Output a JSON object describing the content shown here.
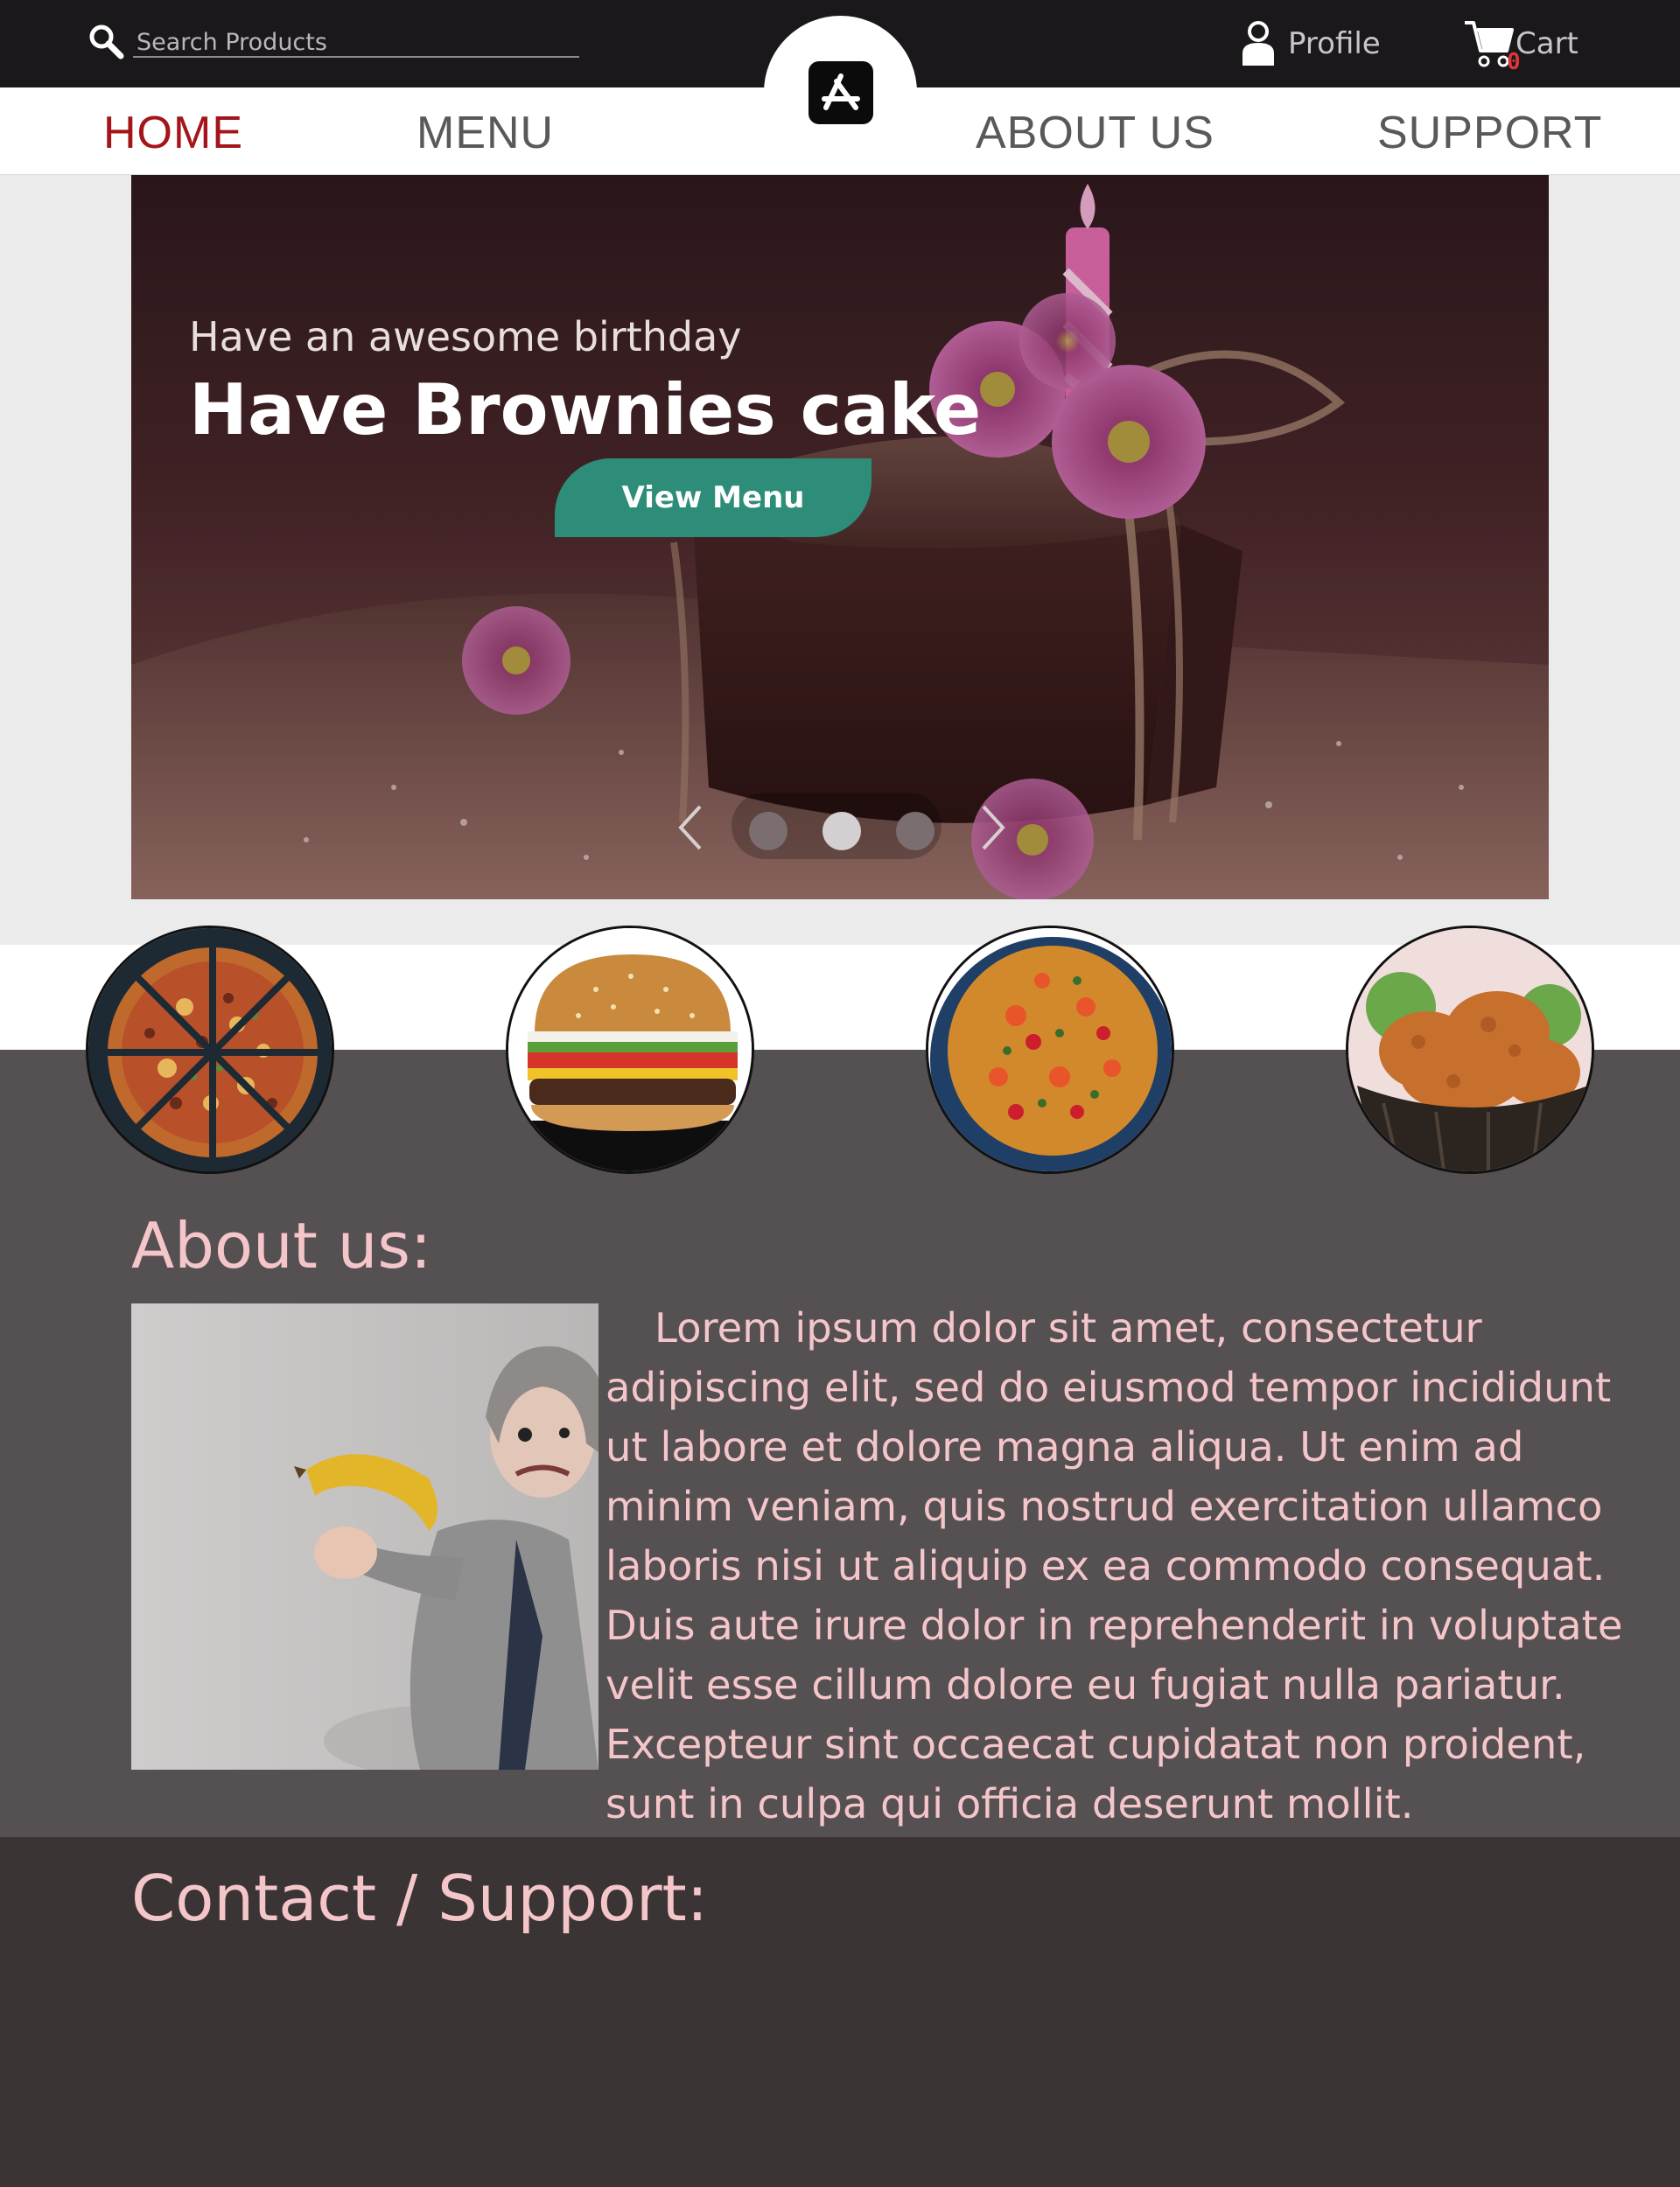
{
  "header": {
    "search": {
      "placeholder": "Search Products",
      "value": ""
    },
    "profile_label": "Profile",
    "cart_label": "Cart",
    "cart_count": "0"
  },
  "nav": {
    "items": [
      {
        "label": "HOME",
        "active": true
      },
      {
        "label": "MENU",
        "active": false
      },
      {
        "label": "ABOUT US",
        "active": false
      },
      {
        "label": "SUPPORT",
        "active": false
      }
    ]
  },
  "hero": {
    "subtitle": "Have an awesome birthday",
    "title": "Have Brownies cake",
    "button_label": "View Menu",
    "slides": {
      "count": 3,
      "active_index": 1
    }
  },
  "food_items": [
    {
      "name": "pizza"
    },
    {
      "name": "burger"
    },
    {
      "name": "paella"
    },
    {
      "name": "fried-chicken"
    }
  ],
  "about": {
    "title": "About us:",
    "text": "Lorem ipsum dolor sit amet, consectetur adipiscing elit, sed do eiusmod tempor incididunt ut labore et dolore magna aliqua. Ut enim ad minim veniam, quis nostrud exercitation ullamco laboris nisi ut aliquip ex ea commodo consequat. Duis aute irure dolor in reprehenderit in voluptate velit esse cillum dolore eu fugiat nulla pariatur. Excepteur sint occaecat cupidatat non proident, sunt in culpa qui officia deserunt mollit."
  },
  "contact": {
    "title": "Contact / Support:"
  },
  "colors": {
    "topbar": "#1a181a",
    "nav_active": "#a4151a",
    "accent_button": "#2e8d78",
    "about_bg": "#555052",
    "contact_bg": "#3a3435",
    "pink_text": "#f5c6c9"
  },
  "icons": [
    "search-icon",
    "user-icon",
    "cart-icon",
    "app-store-icon",
    "chevron-left-icon",
    "chevron-right-icon"
  ]
}
